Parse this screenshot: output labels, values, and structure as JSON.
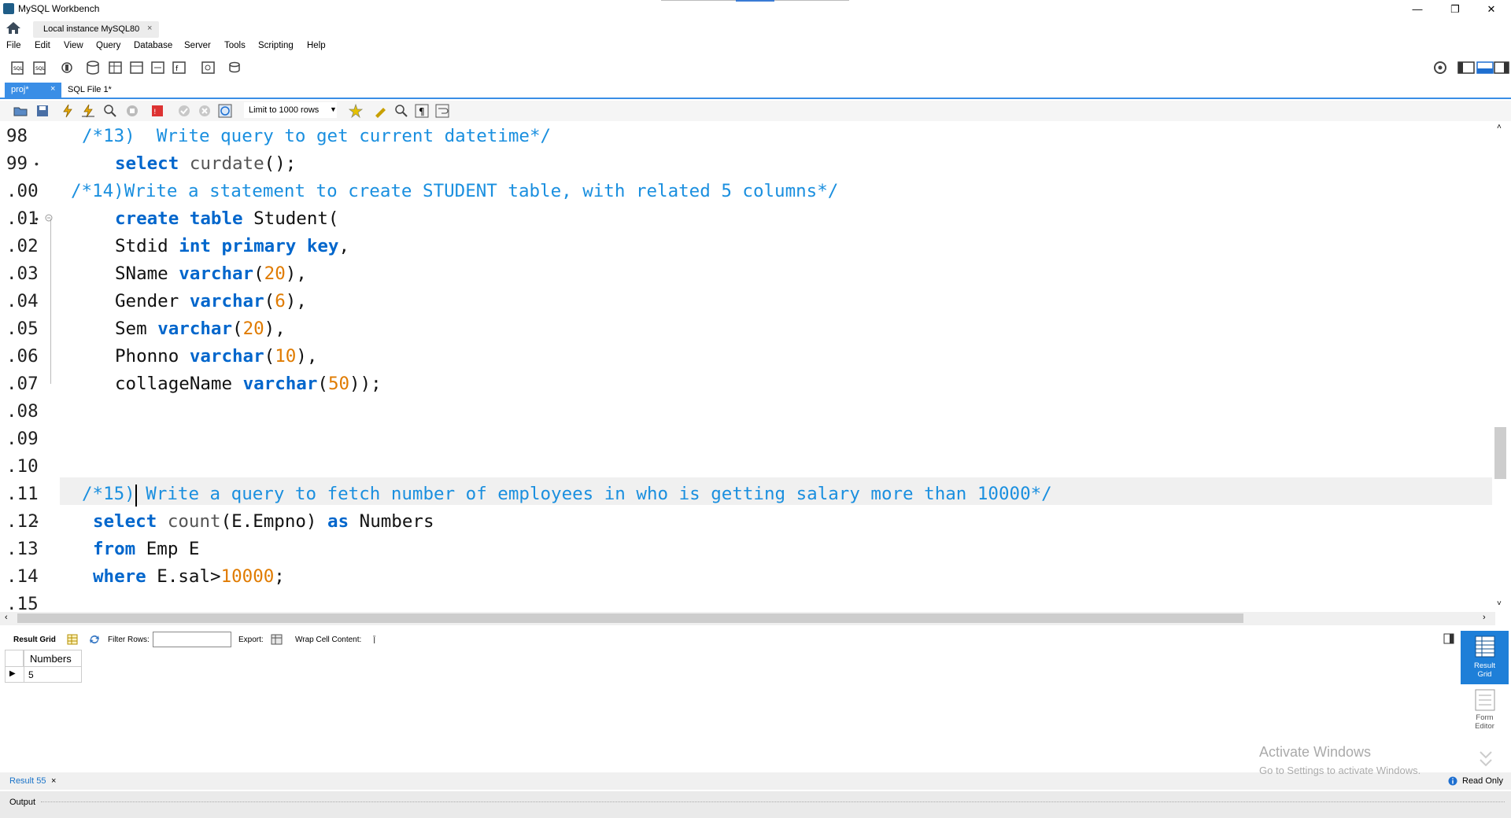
{
  "window": {
    "title": "MySQL Workbench",
    "minimize": "—",
    "restore": "❐",
    "close": "✕"
  },
  "connection_tab": {
    "label": "Local instance MySQL80",
    "close": "×"
  },
  "menu": [
    "File",
    "Edit",
    "View",
    "Query",
    "Database",
    "Server",
    "Tools",
    "Scripting",
    "Help"
  ],
  "editor_tabs": [
    {
      "label": "proj*",
      "close": "×",
      "active": true
    },
    {
      "label": "SQL File 1*",
      "active": false
    }
  ],
  "sql_toolbar": {
    "limit": "Limit to 1000 rows"
  },
  "editor": {
    "line_numbers": [
      "98",
      "99",
      ".00",
      ".01",
      ".02",
      ".03",
      ".04",
      ".05",
      ".06",
      ".07",
      ".08",
      ".09",
      ".10",
      ".11",
      ".12",
      ".13",
      ".14",
      ".15"
    ],
    "statement_dot": "•",
    "code": {
      "l98": "/*13)  Write query to get current datetime*/",
      "l99_kw": "select",
      "l99_fn": "curdate",
      "l99_rest": "();",
      "l100": "/*14)Write a statement to create STUDENT table, with related 5 columns*/",
      "l101_kw1": "create",
      "l101_kw2": "table",
      "l101_id": "Student(",
      "l102_id": "Stdid",
      "l102_kw1": "int",
      "l102_kw2": "primary",
      "l102_kw3": "key",
      "l102_end": ",",
      "l103_id": "SName",
      "l103_kw": "varchar",
      "l103_num": "20",
      "l104_id": "Gender",
      "l104_kw": "varchar",
      "l104_num": "6",
      "l105_id": "Sem",
      "l105_kw": "varchar",
      "l105_num": "20",
      "l106_id": "Phonno",
      "l106_kw": "varchar",
      "l106_num": "10",
      "l107_id": "collageName",
      "l107_kw": "varchar",
      "l107_num": "50",
      "open_paren": "(",
      "close_comma": "),",
      "close_end": "));",
      "l111_a": "/*15)",
      "l111_b": " Write a query to fetch number of employees in who is getting salary more than 10000*/",
      "l112_kw": "select",
      "l112_fn": "count",
      "l112_mid": "(E.Empno)",
      "l112_kw2": "as",
      "l112_id": "Numbers",
      "l113_kw": "from",
      "l113_id": "Emp E",
      "l114_kw": "where",
      "l114_id": "E.sal>",
      "l114_num": "10000",
      "l114_end": ";"
    }
  },
  "result_toolbar": {
    "result_grid": "Result Grid",
    "filter_rows": "Filter Rows:",
    "export": "Export:",
    "wrap": "Wrap Cell Content:"
  },
  "result_table": {
    "columns": [
      "Numbers"
    ],
    "rows": [
      [
        "5"
      ]
    ]
  },
  "side_panel": {
    "result_grid_l1": "Result",
    "result_grid_l2": "Grid",
    "form_editor_l1": "Form",
    "form_editor_l2": "Editor",
    "read_only": "Read Only"
  },
  "bottom": {
    "result_tab": "Result 55",
    "result_close": "×",
    "output": "Output"
  },
  "watermark": {
    "line1": "Activate Windows",
    "line2": "Go to Settings to activate Windows."
  },
  "colors": {
    "accent": "#3a8ee6",
    "keyword": "#0066cc",
    "comment": "#1a8fdf",
    "number": "#e07b00"
  }
}
